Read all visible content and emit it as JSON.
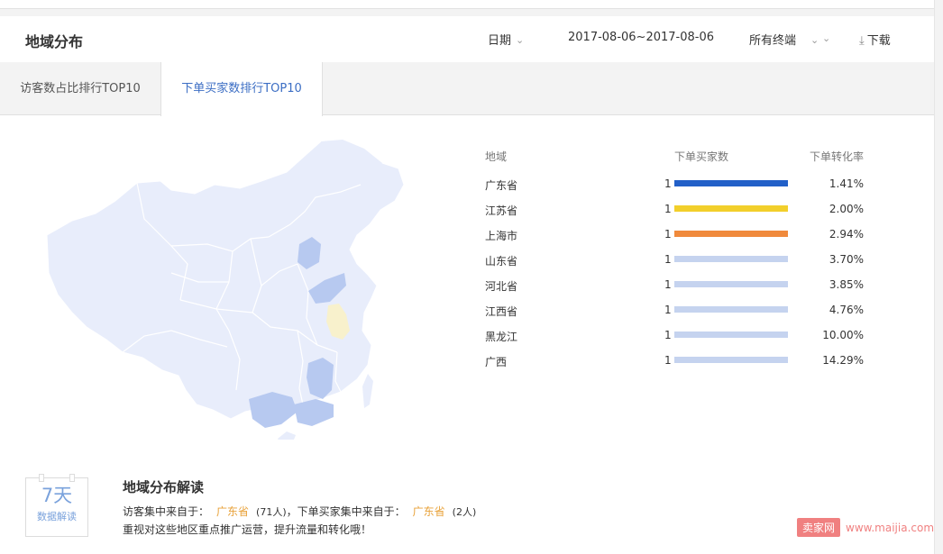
{
  "header": {
    "title": "地域分布",
    "date_label": "日期",
    "date_range": "2017-08-06~2017-08-06",
    "terminal_label": "所有终端",
    "download_label": "下载"
  },
  "tabs": [
    {
      "label": "访客数占比排行TOP10",
      "active": false
    },
    {
      "label": "下单买家数排行TOP10",
      "active": true
    }
  ],
  "table": {
    "headers": {
      "region": "地域",
      "buyers": "下单买家数",
      "rate": "下单转化率"
    },
    "rows": [
      {
        "name": "广东省",
        "count": "1",
        "rate": "1.41%",
        "bar_color": "#2260c8"
      },
      {
        "name": "江苏省",
        "count": "1",
        "rate": "2.00%",
        "bar_color": "#f2cf2b"
      },
      {
        "name": "上海市",
        "count": "1",
        "rate": "2.94%",
        "bar_color": "#f08a3c"
      },
      {
        "name": "山东省",
        "count": "1",
        "rate": "3.70%",
        "bar_color": "#c5d3ef"
      },
      {
        "name": "河北省",
        "count": "1",
        "rate": "3.85%",
        "bar_color": "#c5d3ef"
      },
      {
        "name": "江西省",
        "count": "1",
        "rate": "4.76%",
        "bar_color": "#c5d3ef"
      },
      {
        "name": "黑龙江",
        "count": "1",
        "rate": "10.00%",
        "bar_color": "#c5d3ef"
      },
      {
        "name": "广西",
        "count": "1",
        "rate": "14.29%",
        "bar_color": "#c5d3ef"
      }
    ]
  },
  "insight": {
    "badge_big": "7天",
    "badge_small": "数据解读",
    "title": "地域分布解读",
    "visitors_prefix": "访客集中来自于：",
    "visitors_region": "广东省",
    "visitors_count": "(71人)",
    "buyers_prefix": "，下单买家集中来自于：",
    "buyers_region": "广东省",
    "buyers_count": "(2人)",
    "advice": "重视对这些地区重点推广运营，提升流量和转化哦！"
  },
  "watermark": {
    "logo": "卖家网",
    "url": "www.maijia.com"
  },
  "colors": {
    "accent": "#3c6ec4",
    "highlight": "#e8a23a",
    "map_base": "#e8edfb",
    "map_active": "#b7c9f0",
    "map_yellow": "#f8f1cc"
  },
  "icons": {
    "chevron": "chevron-down-icon",
    "download": "download-icon"
  }
}
